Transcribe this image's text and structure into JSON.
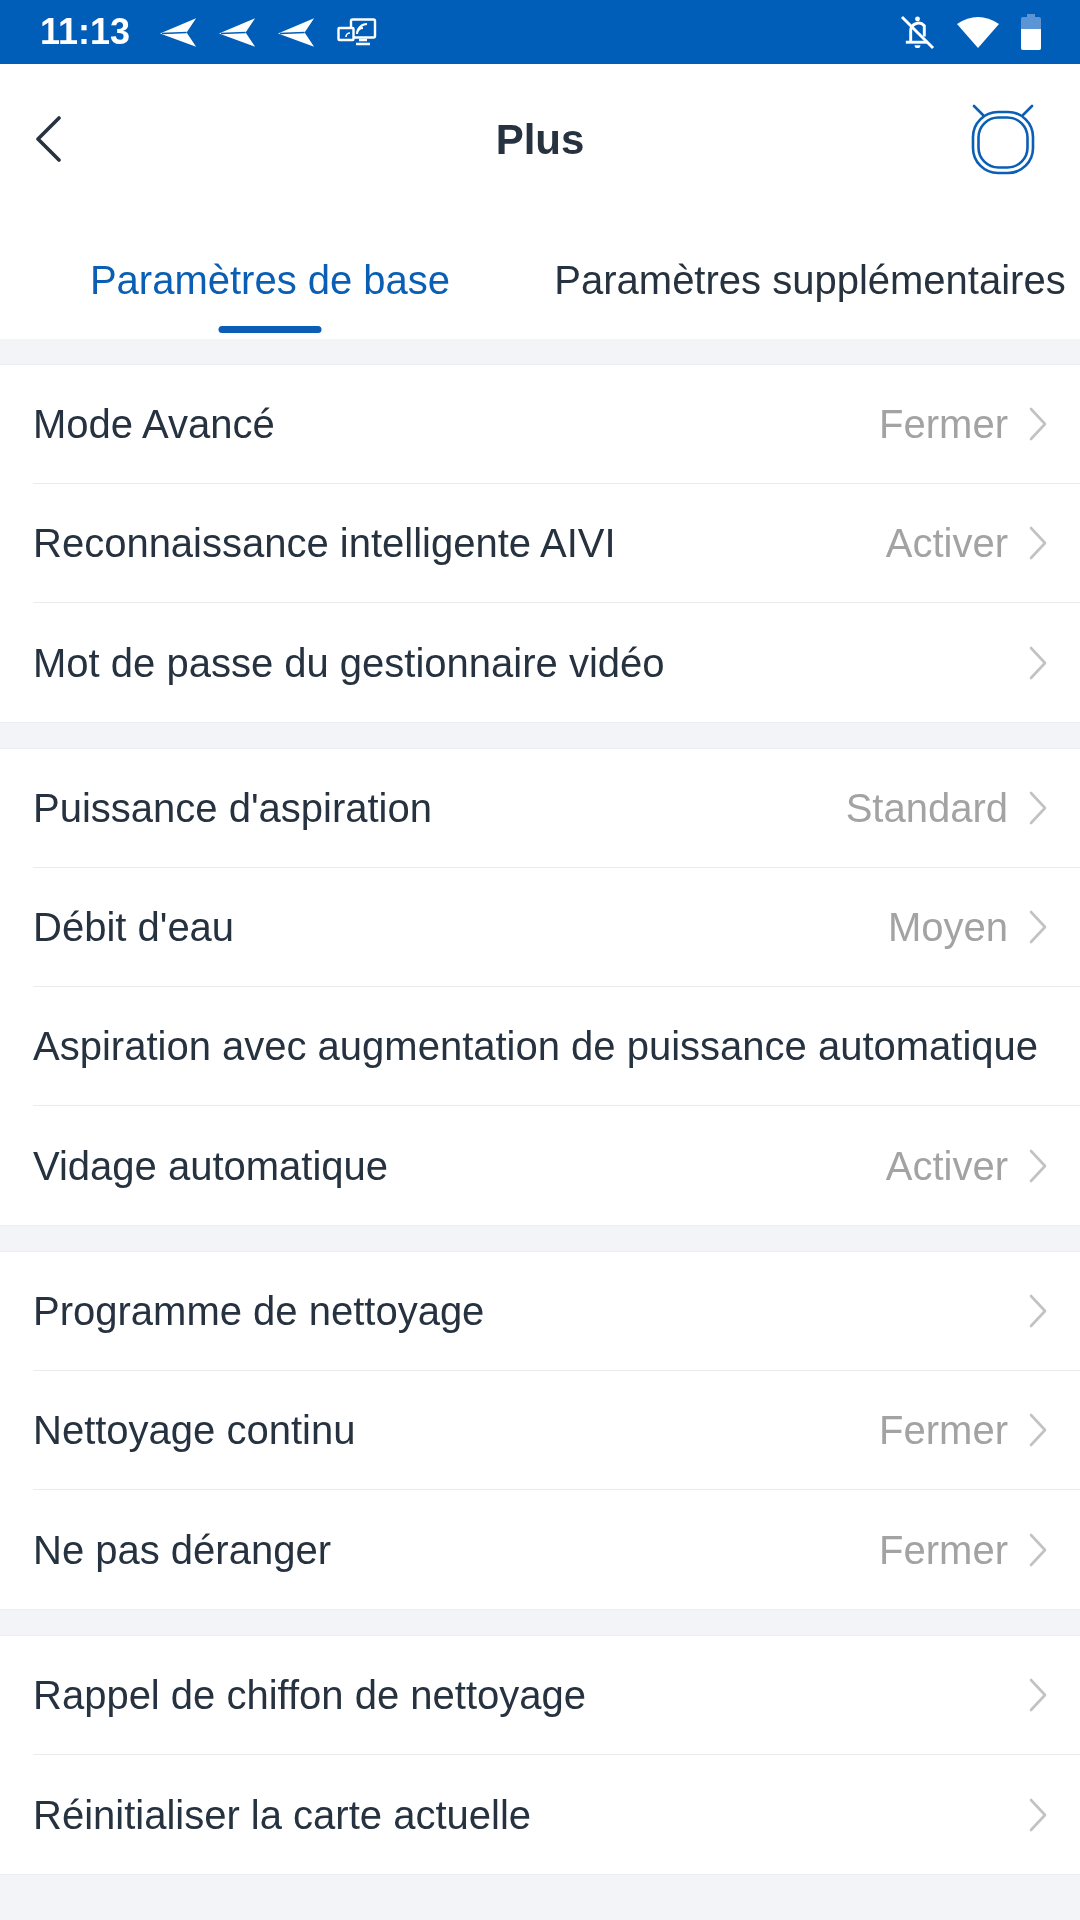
{
  "status_bar": {
    "time": "11:13"
  },
  "header": {
    "title": "Plus"
  },
  "tabs": [
    {
      "label": "Paramètres de base",
      "selected": true
    },
    {
      "label": "Paramètres supplémentaires",
      "selected": false
    }
  ],
  "sections": [
    {
      "rows": [
        {
          "label": "Mode Avancé",
          "value": "Fermer",
          "chevron": true
        },
        {
          "label": "Reconnaissance intelligente AIVI",
          "value": "Activer",
          "chevron": true
        },
        {
          "label": "Mot de passe du gestionnaire vidéo",
          "chevron": true
        }
      ]
    },
    {
      "rows": [
        {
          "label": "Puissance d'aspiration",
          "value": "Standard",
          "chevron": true
        },
        {
          "label": "Débit d'eau",
          "value": "Moyen",
          "chevron": true
        },
        {
          "label": "Aspiration avec augmentation de puissance automatique",
          "chevron": false
        },
        {
          "label": "Vidage automatique",
          "value": "Activer",
          "chevron": true
        }
      ]
    },
    {
      "rows": [
        {
          "label": "Programme de nettoyage",
          "chevron": true
        },
        {
          "label": "Nettoyage continu",
          "value": "Fermer",
          "chevron": true
        },
        {
          "label": "Ne pas déranger",
          "value": "Fermer",
          "chevron": true
        }
      ]
    },
    {
      "rows": [
        {
          "label": "Rappel de chiffon de nettoyage",
          "chevron": true
        },
        {
          "label": "Réinitialiser la carte actuelle",
          "chevron": true
        }
      ]
    }
  ]
}
